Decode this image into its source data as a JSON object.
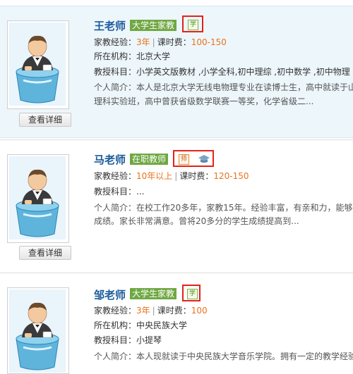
{
  "tutors": [
    {
      "name": "王老师",
      "badge": "大学生家教",
      "cert_icons": [
        "student-cert-icon"
      ],
      "experience_label": "家教经验：",
      "experience_value": "3年",
      "fee_label": "课时费：",
      "fee_value": "100-150",
      "org_label": "所在机构：",
      "org_value": "北京大学",
      "subjects_label": "教授科目：",
      "subjects_value": "小学英文版教材 ,小学全科,初中理综 ,初中数学 ,初中物理",
      "intro_label": "个人简介：",
      "intro_line1": "本人是北京大学无线电物理专业在读博士生，高中就读于山",
      "intro_line2": "理科实验班，高中曾获省级数学联赛一等奖，化学省级二...",
      "detail_button": "查看详细"
    },
    {
      "name": "马老师",
      "badge": "在职教师",
      "cert_icons": [
        "teacher-cert-icon",
        "graduate-cap-icon"
      ],
      "experience_label": "家教经验：",
      "experience_value": "10年以上",
      "fee_label": "课时费：",
      "fee_value": "120-150",
      "subjects_label": "教授科目：",
      "subjects_value": "...",
      "intro_label": "个人简介：",
      "intro_line1": "在校工作20多年，家教15年。经验丰富，有亲和力，能够",
      "intro_line2": "成绩。家长非常满意。曾将20多分的学生成绩提高到...",
      "detail_button": "查看详细"
    },
    {
      "name": "邹老师",
      "badge": "大学生家教",
      "cert_icons": [
        "student-cert-icon"
      ],
      "experience_label": "家教经验：",
      "experience_value": "3年",
      "fee_label": "课时费：",
      "fee_value": "100",
      "org_label": "所在机构：",
      "org_value": "中央民族大学",
      "subjects_label": "教授科目：",
      "subjects_value": "小提琴",
      "intro_label": "个人简介：",
      "intro_line1": "本人现就读于中央民族大学音乐学院。拥有一定的教学经验",
      "detail_button": "查看详细"
    }
  ],
  "cert_glyphs": {
    "student": "学",
    "teacher": "师"
  },
  "colors": {
    "name": "#1a5a9a",
    "badge": "#6fa843",
    "highlight": "#e8731c",
    "frame": "#e3221b"
  }
}
